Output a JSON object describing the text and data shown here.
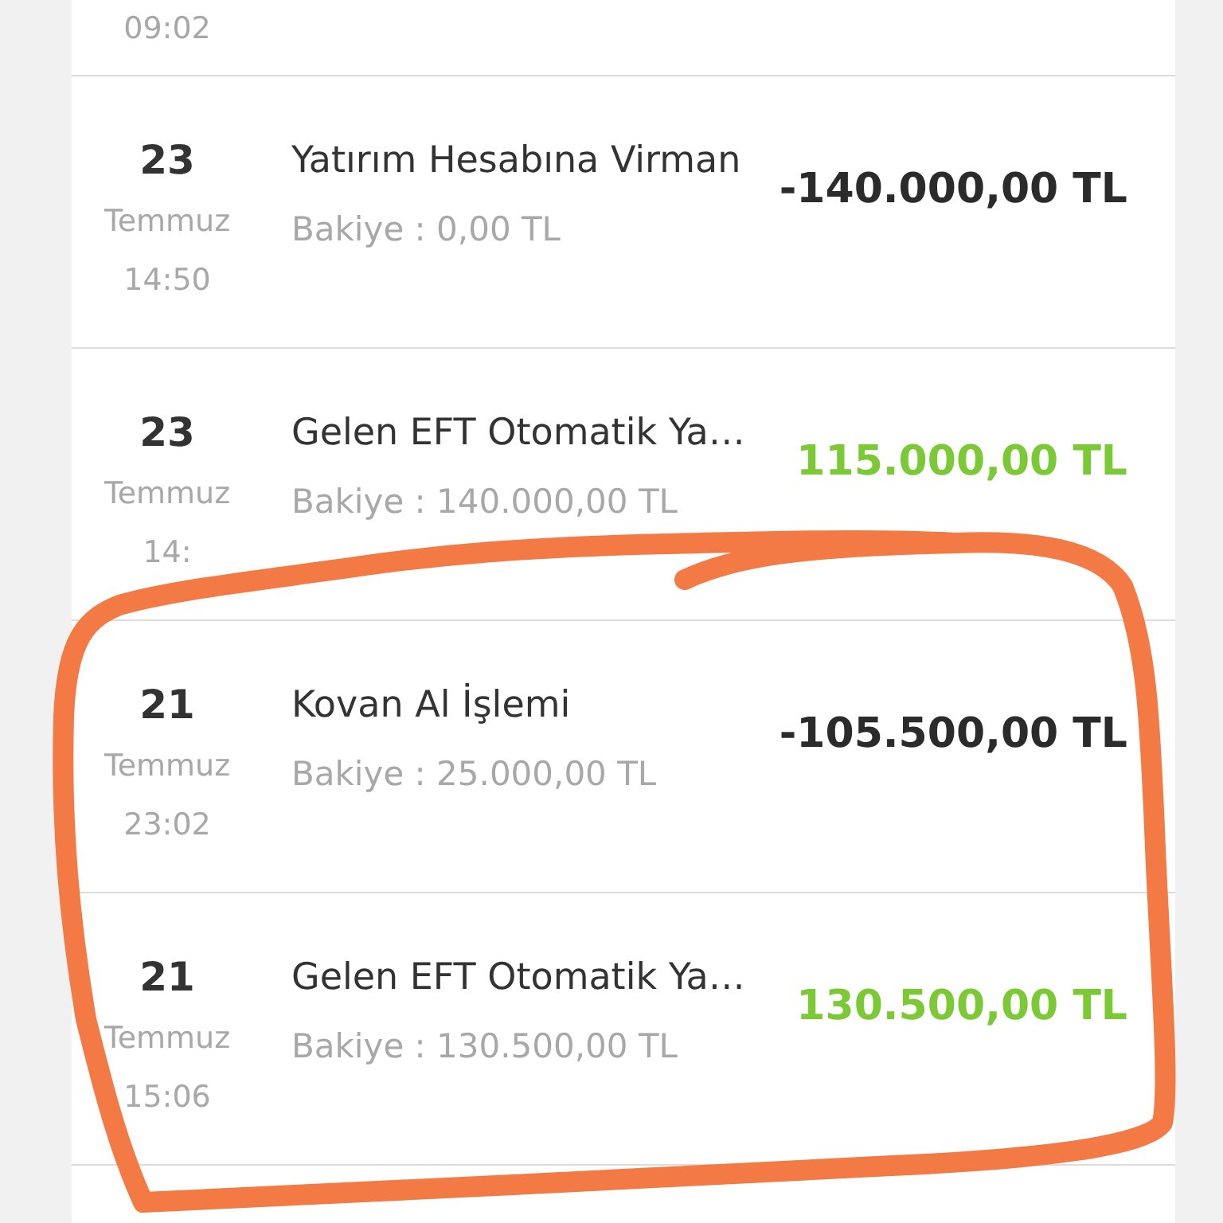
{
  "top_row": {
    "time": "09:02"
  },
  "transactions": [
    {
      "day": "23",
      "month": "Temmuz",
      "time": "14:50",
      "title": "Yatırım Hesabına Virman",
      "balance": "Bakiye : 0,00 TL",
      "amount": "-140.000,00 TL",
      "kind": "debit"
    },
    {
      "day": "23",
      "month": "Temmuz",
      "time": "14:",
      "title": "Gelen EFT Otomatik Ya…",
      "balance": "Bakiye : 140.000,00 TL",
      "amount": "115.000,00 TL",
      "kind": "credit"
    },
    {
      "day": "21",
      "month": "Temmuz",
      "time": "23:02",
      "title": "Kovan Al İşlemi",
      "balance": "Bakiye : 25.000,00 TL",
      "amount": "-105.500,00 TL",
      "kind": "debit"
    },
    {
      "day": "21",
      "month": "Temmuz",
      "time": "15:06",
      "title": "Gelen EFT Otomatik Ya…",
      "balance": "Bakiye : 130.500,00 TL",
      "amount": "130.500,00 TL",
      "kind": "credit"
    }
  ]
}
